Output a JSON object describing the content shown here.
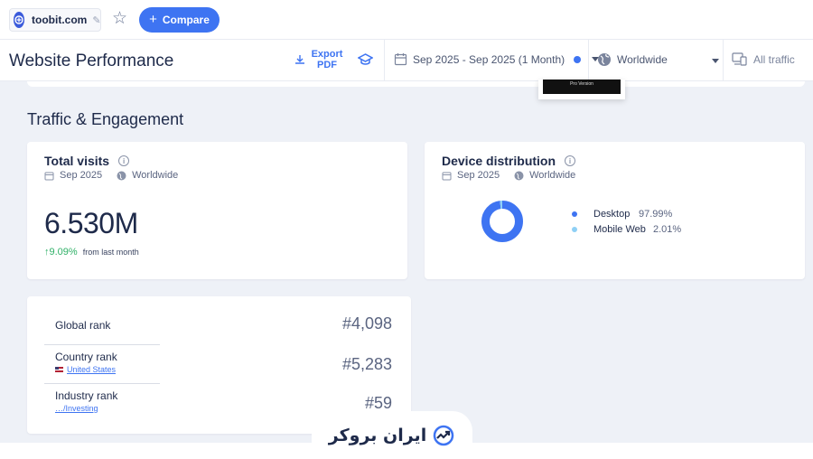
{
  "topbar": {
    "site": "toobit.com",
    "compare_label": "Compare"
  },
  "header": {
    "title": "Website Performance",
    "export_label": "Export PDF",
    "date_range": "Sep 2025 - Sep 2025 (1 Month)",
    "geo": "Worldwide",
    "traffic": "All traffic"
  },
  "popup": {
    "text": "Pro Version"
  },
  "section": {
    "title": "Traffic & Engagement"
  },
  "visits": {
    "title": "Total visits",
    "period": "Sep 2025",
    "geo": "Worldwide",
    "value": "6.530M",
    "change": "9.09%",
    "change_label": "from last month"
  },
  "device": {
    "title": "Device distribution",
    "period": "Sep 2025",
    "geo": "Worldwide",
    "items": [
      {
        "name": "Desktop",
        "value": "97.99%",
        "share": 97.99,
        "color": "#3e74f2"
      },
      {
        "name": "Mobile Web",
        "value": "2.01%",
        "share": 2.01,
        "color": "#8fd0f5"
      }
    ]
  },
  "ranks": {
    "global_label": "Global rank",
    "global_value": "#4,098",
    "country_label": "Country rank",
    "country_link": "United States",
    "country_value": "#5,283",
    "industry_label": "Industry rank",
    "industry_link": "…/Investing",
    "industry_value": "#59"
  },
  "watermark": {
    "text": "ایران بروکر"
  },
  "colors": {
    "accent": "#3e74f2",
    "positive": "#2fb067",
    "background": "#eef1f7"
  }
}
